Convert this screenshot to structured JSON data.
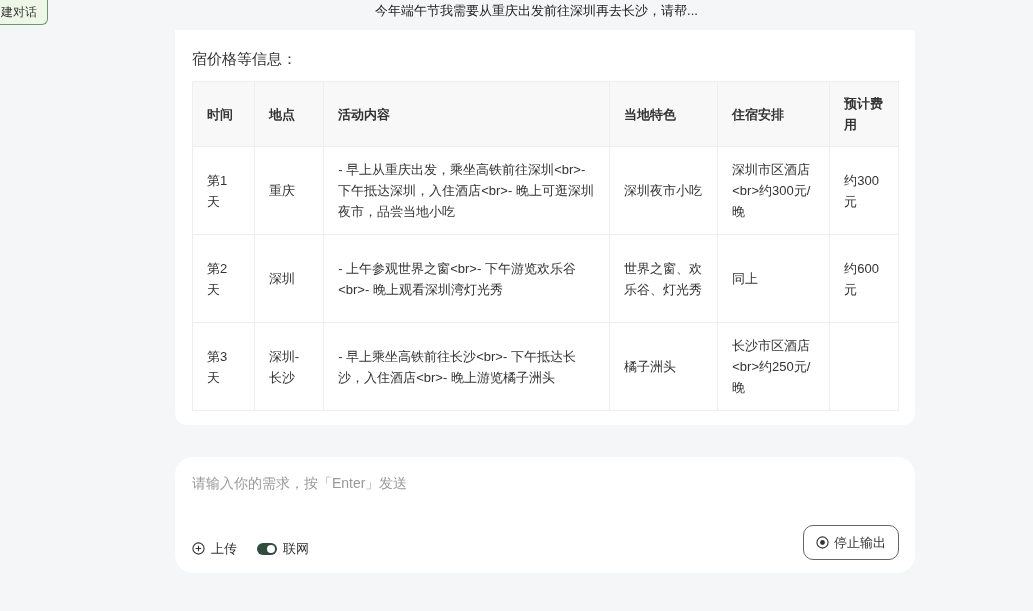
{
  "new_chat_button": {
    "label": "建对话"
  },
  "header": {
    "title": "今年端午节我需要从重庆出发前往深圳再去长沙，请帮..."
  },
  "message": {
    "text": "宿价格等信息：",
    "table": {
      "columns": [
        "时间",
        "地点",
        "活动内容",
        "当地特色",
        "住宿安排",
        "预计费用"
      ],
      "rows": [
        [
          "第1天",
          "重庆",
          "- 早上从重庆出发，乘坐高铁前往深圳<br>- 下午抵达深圳，入住酒店<br>- 晚上可逛深圳夜市，品尝当地小吃",
          "深圳夜市小吃",
          "深圳市区酒店<br>约300元/晚",
          "约300元"
        ],
        [
          "第2天",
          "深圳",
          "- 上午参观世界之窗<br>- 下午游览欢乐谷<br>- 晚上观看深圳湾灯光秀",
          "世界之窗、欢乐谷、灯光秀",
          "同上",
          "约600元"
        ],
        [
          "第3天",
          "深圳-长沙",
          "- 早上乘坐高铁前往长沙<br>- 下午抵达长沙，入住酒店<br>- 晚上游览橘子洲头",
          "橘子洲头",
          "长沙市区酒店<br>约250元/晚",
          null
        ]
      ]
    }
  },
  "composer": {
    "placeholder": "请输入你的需求，按「Enter」发送",
    "upload": {
      "label": "上传"
    },
    "web_search": {
      "label": "联网",
      "on": true
    },
    "stop_button": {
      "label": "停止输出"
    }
  }
}
